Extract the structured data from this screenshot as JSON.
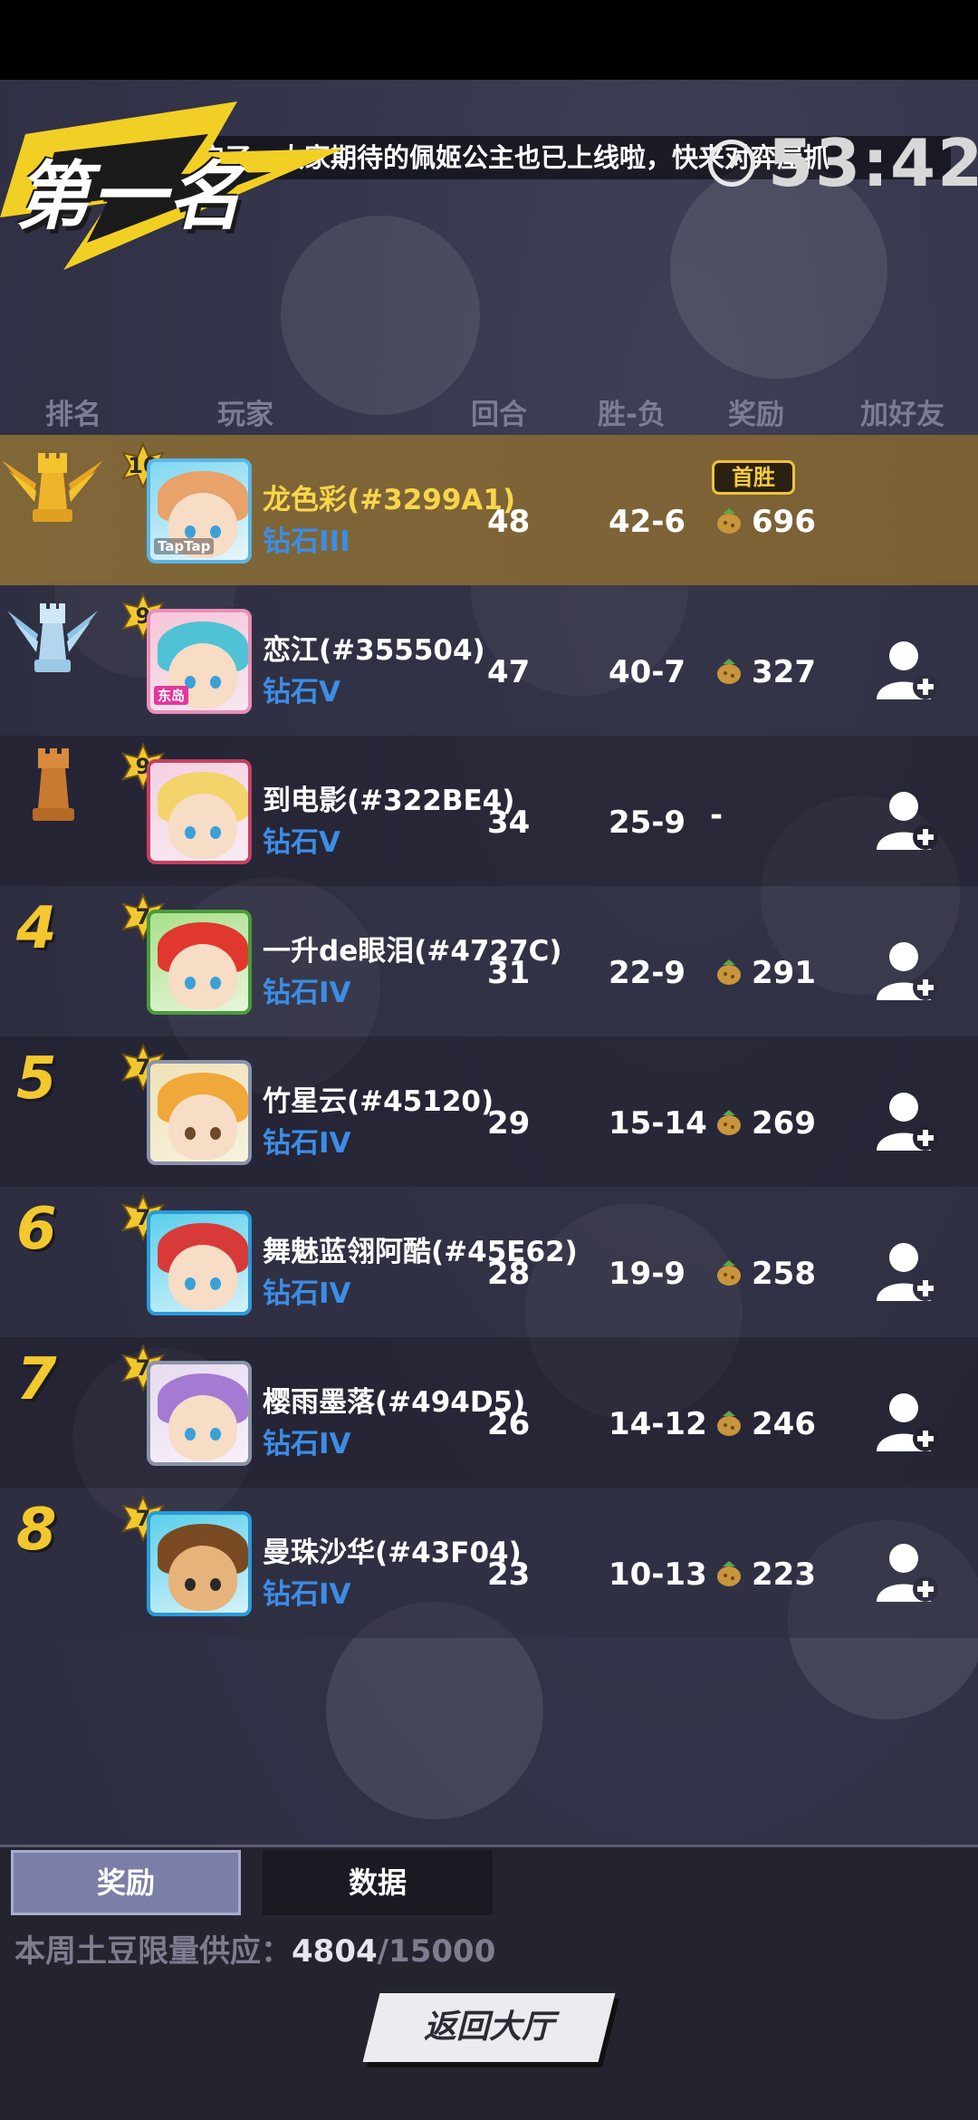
{
  "header": {
    "banner_title": "第一名",
    "ticker_text": "经开启了，大家期待的佩姬公主也已上线啦，快来对弈屋抓",
    "timer": "53:42"
  },
  "columns": {
    "rank": "排名",
    "player": "玩家",
    "rounds": "回合",
    "win_loss": "胜-负",
    "reward": "奖励",
    "add_friend": "加好友"
  },
  "rows": [
    {
      "rank": "1",
      "rank_icon": "gold-crown-icon",
      "level": "10",
      "name": "龙色彩(#3299A1)",
      "tier": "钻石III",
      "rounds": "48",
      "win_loss": "42-6",
      "reward": "696",
      "first_win": "首胜",
      "avatar_tag": "TapTap",
      "highlight": true
    },
    {
      "rank": "2",
      "rank_icon": "silver-crown-icon",
      "level": "9",
      "name": "恋江(#355504)",
      "tier": "钻石V",
      "rounds": "47",
      "win_loss": "40-7",
      "reward": "327",
      "avatar_tag": "东岛"
    },
    {
      "rank": "3",
      "rank_icon": "bronze-rook-icon",
      "level": "9",
      "name": "到电影(#322BE4)",
      "tier": "钻石V",
      "rounds": "34",
      "win_loss": "25-9",
      "reward": "-"
    },
    {
      "rank": "4",
      "level": "7",
      "name": "一升de眼泪(#4727C)",
      "tier": "钻石IV",
      "rounds": "31",
      "win_loss": "22-9",
      "reward": "291"
    },
    {
      "rank": "5",
      "level": "7",
      "name": "竹星云(#45120)",
      "tier": "钻石IV",
      "rounds": "29",
      "win_loss": "15-14",
      "reward": "269"
    },
    {
      "rank": "6",
      "level": "7",
      "name": "舞魅蓝翎阿酷(#45E62)",
      "tier": "钻石IV",
      "rounds": "28",
      "win_loss": "19-9",
      "reward": "258"
    },
    {
      "rank": "7",
      "level": "7",
      "name": "樱雨墨落(#494D5)",
      "tier": "钻石IV",
      "rounds": "26",
      "win_loss": "14-12",
      "reward": "246"
    },
    {
      "rank": "8",
      "level": "7",
      "name": "曼珠沙华(#43F04)",
      "tier": "钻石IV",
      "rounds": "23",
      "win_loss": "10-13",
      "reward": "223"
    }
  ],
  "tabs": {
    "rewards": "奖励",
    "stats": "数据"
  },
  "supply": {
    "label": "本周土豆限量供应：",
    "current": "4804",
    "max": "/15000"
  },
  "return_button": "返回大厅",
  "colors": {
    "gold": "#f3c82e",
    "tier_blue": "#3c8de6",
    "highlight_row": "#806738"
  }
}
